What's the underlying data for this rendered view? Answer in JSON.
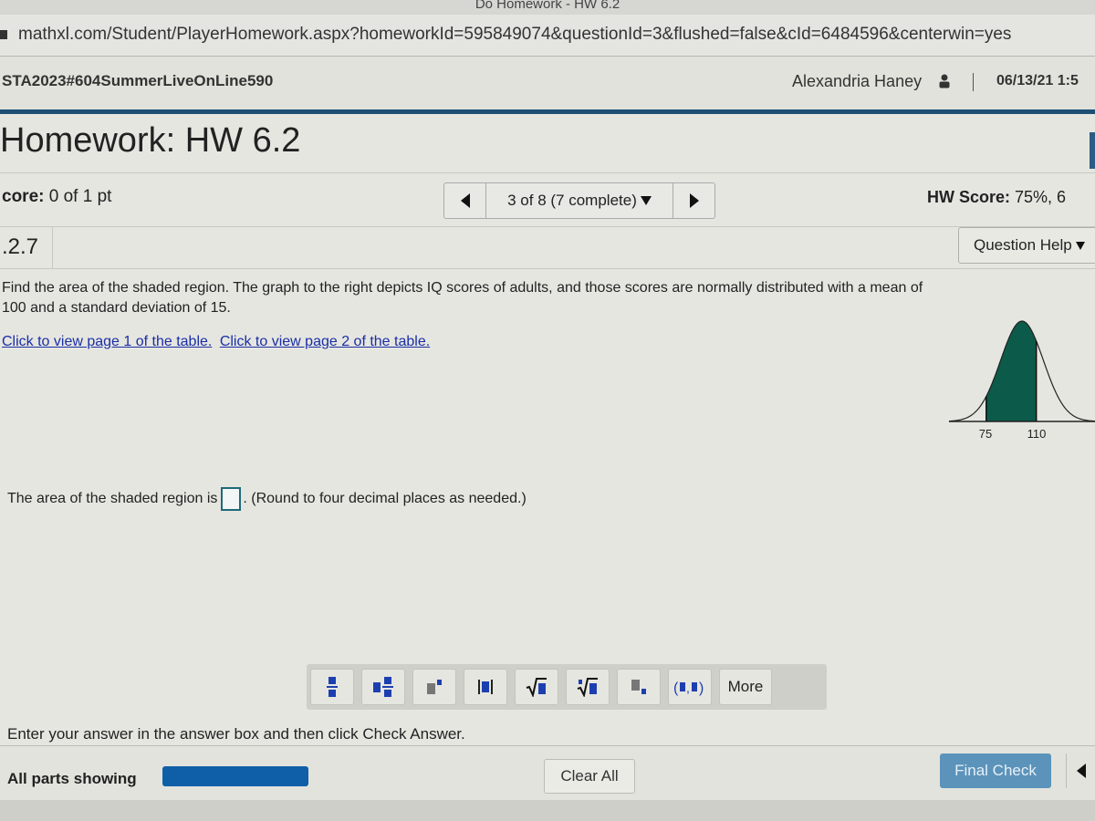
{
  "window": {
    "title": "Do Homework - HW 6.2"
  },
  "browser": {
    "url": "mathxl.com/Student/PlayerHomework.aspx?homeworkId=595849074&questionId=3&flushed=false&cId=6484596&centerwin=yes"
  },
  "header": {
    "course": "STA2023#604SummerLiveOnLine590",
    "user": "Alexandria Haney",
    "user_icon": "user-icon",
    "datetime": "06/13/21 1:5"
  },
  "homework": {
    "title": "Homework: HW 6.2",
    "score_label": "core:",
    "score_value": "0 of 1 pt",
    "nav_position": "3 of 8 (7 complete)",
    "hw_score_label": "HW Score:",
    "hw_score_value": "75%, 6",
    "question_number": ".2.7",
    "question_help": "Question Help"
  },
  "question": {
    "text": "Find the area of the shaded region. The graph to the right depicts IQ scores of adults, and those scores are normally distributed with a mean of 100 and a standard deviation of 15.",
    "link1": "Click to view page 1 of the table.",
    "link2": "Click to view page 2 of the table.",
    "graph": {
      "mean": 100,
      "sd": 15,
      "shade_from": 75,
      "shade_to": 110,
      "tick_labels": [
        "75",
        "110"
      ],
      "fill_color": "#0b5a4a"
    },
    "answer_prefix": "The area of the shaded region is",
    "answer_value": "",
    "answer_suffix": ". (Round to four decimal places as needed.)"
  },
  "toolbar": {
    "buttons": [
      {
        "name": "fraction"
      },
      {
        "name": "mixed-number"
      },
      {
        "name": "exponent"
      },
      {
        "name": "absolute-value"
      },
      {
        "name": "square-root"
      },
      {
        "name": "nth-root"
      },
      {
        "name": "subscript"
      },
      {
        "name": "ordered-pair"
      }
    ],
    "more_label": "More"
  },
  "footer": {
    "instructions": "Enter your answer in the answer box and then click Check Answer.",
    "parts_label": "All parts showing",
    "parts_progress": 1.0,
    "clear_all": "Clear All",
    "final_check": "Final Check"
  }
}
